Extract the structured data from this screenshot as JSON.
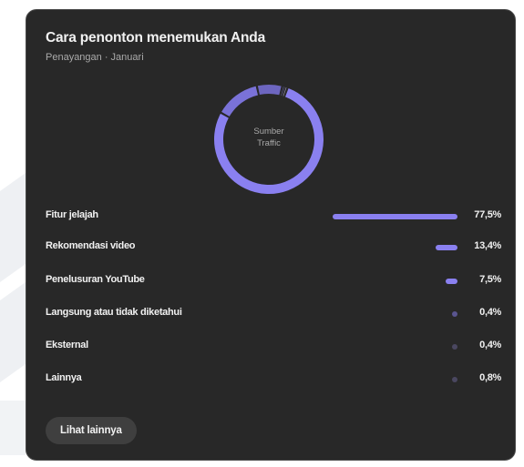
{
  "card": {
    "title": "Cara penonton menemukan Anda",
    "subtitle": "Penayangan · Januari"
  },
  "donut": {
    "center_label_line1": "Sumber",
    "center_label_line2": "Traffic"
  },
  "colors": {
    "card_bg": "#282828",
    "bar": "#8a80f0",
    "bar_faint": "#5a5590"
  },
  "sources": [
    {
      "label": "Fitur jelajah",
      "value": "77,5%",
      "share": 77.5
    },
    {
      "label": "Rekomendasi video",
      "value": "13,4%",
      "share": 13.4
    },
    {
      "label": "Penelusuran YouTube",
      "value": "7,5%",
      "share": 7.5
    },
    {
      "label": "Langsung atau tidak diketahui",
      "value": "0,4%",
      "share": 0.4
    },
    {
      "label": "Eksternal",
      "value": "0,4%",
      "share": 0.4
    },
    {
      "label": "Lainnya",
      "value": "0,8%",
      "share": 0.8
    }
  ],
  "button": {
    "label": "Lihat lainnya"
  }
}
